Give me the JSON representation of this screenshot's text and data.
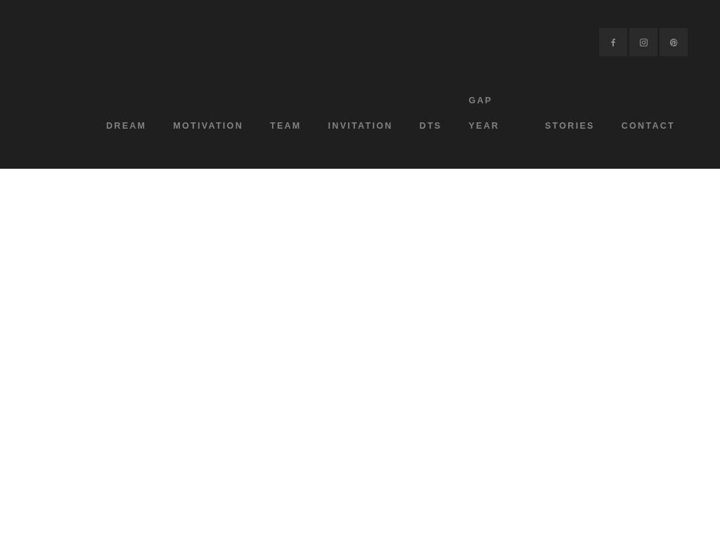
{
  "social_links": [
    {
      "kind": "facebook"
    },
    {
      "kind": "instagram"
    },
    {
      "kind": "pinterest"
    }
  ],
  "nav": {
    "items": [
      {
        "label": "DREAM"
      },
      {
        "label": "MOTIVATION"
      },
      {
        "label": "TEAM"
      },
      {
        "label": "INVITATION"
      },
      {
        "label": "DTS"
      },
      {
        "label": "GAP YEAR"
      },
      {
        "label": "STORIES"
      },
      {
        "label": "CONTACT"
      }
    ]
  }
}
